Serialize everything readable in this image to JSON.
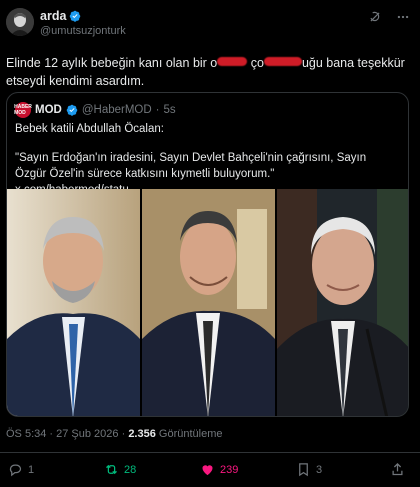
{
  "author": {
    "name": "arda",
    "handle": "@umutsuzjonturk"
  },
  "tweet": {
    "text_before": "Elinde 12 aylık bebeğin kanı olan bir o",
    "text_mid": " ço",
    "text_after": "uğu bana teşekkür etseydi kendimi asardım."
  },
  "quote": {
    "logo": "HABER MOD",
    "name": "MOD",
    "handle": "@HaberMOD",
    "separator": "·",
    "time": "5s",
    "line1": "Bebek katili Abdullah Öcalan:",
    "body": "\"Sayın Erdoğan'ın iradesini, Sayın Devlet Bahçeli'nin çağrısını, Sayın Özgür Özel'in sürece katkısını kıymetli buluyorum.\"  x.com/habermod/statu..."
  },
  "meta": {
    "time": "ÖS 5:34 · 27 Şub 2026 · ",
    "views": "2.356",
    "views_label": " Görüntüleme"
  },
  "actions": {
    "replies": "1",
    "reposts": "28",
    "likes": "239",
    "bookmarks": "3"
  },
  "colors": {
    "verified": "#1d9bf0",
    "retweet": "#00ba7c",
    "like": "#f91880",
    "muted": "#71767b"
  },
  "icons": [
    "verified-badge-icon",
    "grok-icon",
    "more-icon",
    "reply-icon",
    "retweet-icon",
    "like-icon",
    "bookmark-icon",
    "share-icon"
  ]
}
